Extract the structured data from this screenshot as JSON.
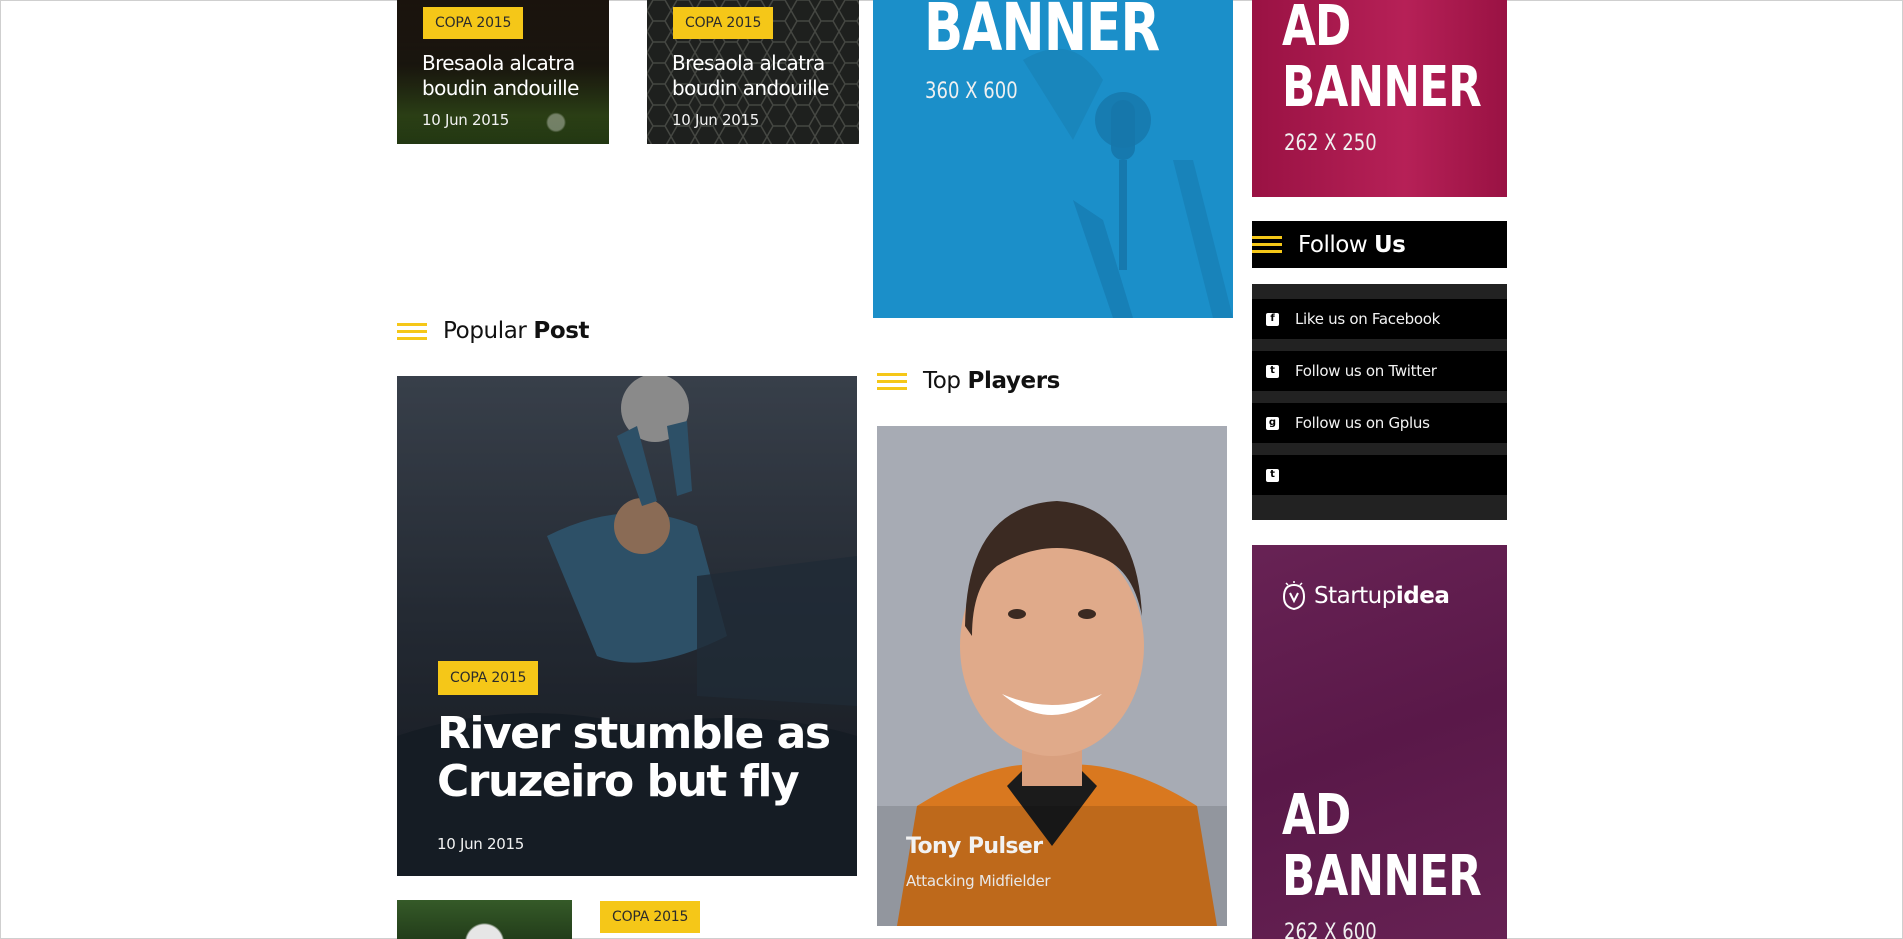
{
  "top_cards": [
    {
      "tag": "COPA 2015",
      "title": "Bresaola alcatra boudin andouille",
      "date": "10 Jun 2015"
    },
    {
      "tag": "COPA 2015",
      "title": "Bresaola alcatra boudin andouille",
      "date": "10 Jun 2015"
    }
  ],
  "banner_large": {
    "title": "BANNER",
    "size": "360 X 600",
    "color": "#1b8fc9"
  },
  "banner_small": {
    "line1": "AD",
    "line2": "BANNER",
    "size": "262 X 250",
    "color": "#b0174f"
  },
  "follow": {
    "title_regular": "Follow",
    "title_bold": "Us",
    "items": [
      {
        "icon": "facebook-icon",
        "label": "Like us on Facebook"
      },
      {
        "icon": "twitter-icon",
        "label": "Follow us on Twitter"
      },
      {
        "icon": "gplus-icon",
        "label": "Follow us on Gplus"
      },
      {
        "icon": "tumblr-icon",
        "label": ""
      }
    ]
  },
  "popular": {
    "title_regular": "Popular",
    "title_bold": "Post",
    "tag": "COPA 2015",
    "headline": "River stumble as Cruzeiro but fly",
    "date": "10 Jun 2015"
  },
  "players": {
    "title_regular": "Top",
    "title_bold": "Players",
    "name": "Tony Pulser",
    "position": "Attacking Midfielder"
  },
  "ad_bottom": {
    "brand_regular": "Startup",
    "brand_bold": "idea",
    "line1": "AD",
    "line2": "BANNER",
    "size": "262 X 600",
    "color": "#5e1a4c"
  },
  "bottom_row": {
    "tag": "COPA 2015"
  },
  "colors": {
    "accent": "#f5c718",
    "dark": "#000000"
  }
}
